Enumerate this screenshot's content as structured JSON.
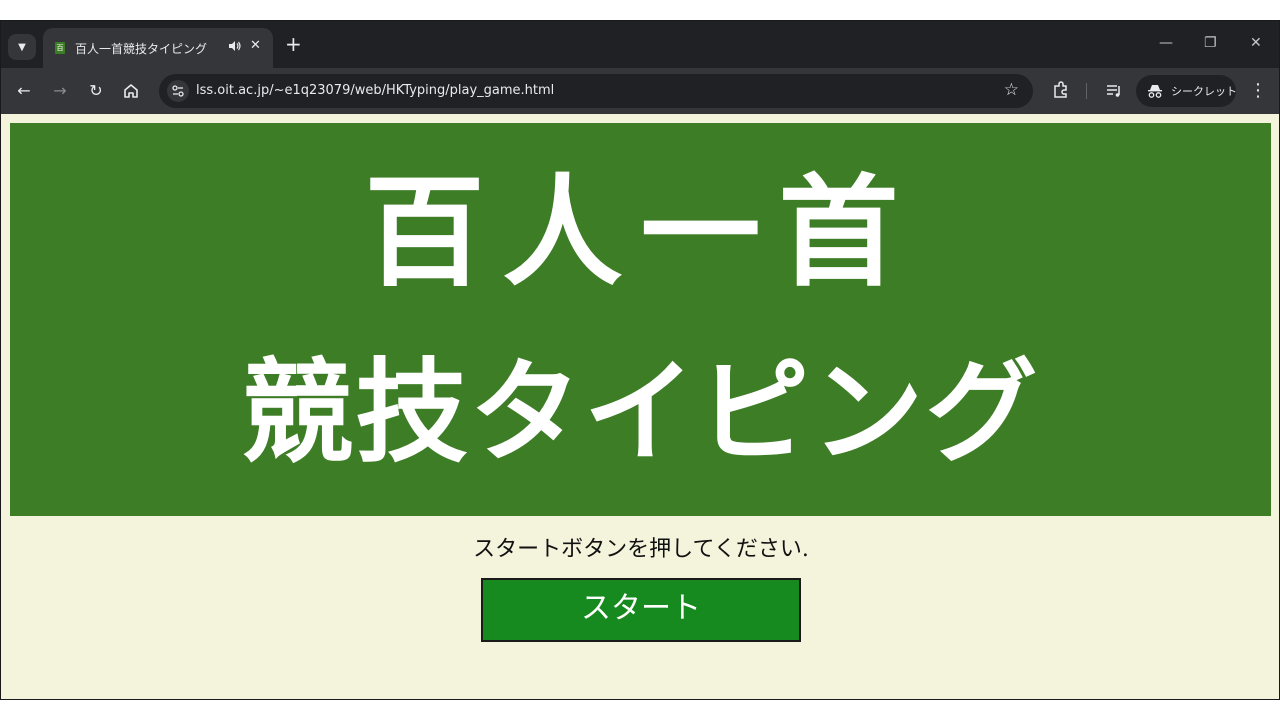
{
  "browser": {
    "tab": {
      "title": "百人一首競技タイピング"
    },
    "window_controls": {
      "minimize": "—",
      "restore": "❐",
      "close": "✕"
    },
    "new_tab": "+",
    "address": {
      "url": "lss.oit.ac.jp/~e1q23079/web/HKTyping/play_game.html"
    },
    "incognito": {
      "label": "シークレット"
    }
  },
  "page": {
    "banner": {
      "line1": "百人一首",
      "line2": "競技タイピング"
    },
    "instruction": "スタートボタンを押してください.",
    "start_button": {
      "label": "スタート"
    }
  },
  "colors": {
    "page_bg": "#f4f3dc",
    "banner_green": "#3d7d26",
    "button_green": "#168a1e",
    "chrome_dark": "#202124",
    "chrome_toolbar": "#35363a"
  }
}
